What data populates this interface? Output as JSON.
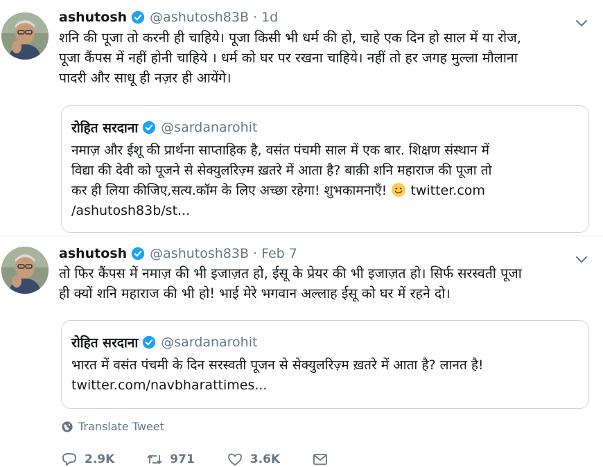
{
  "tweets": [
    {
      "name": "ashutosh",
      "handle": "@ashutosh83B",
      "separator": "·",
      "time": "1d",
      "text": "शनि की पूजा तो करनी ही चाहिये। पूजा किसी भी धर्म की हो, चाहे एक दिन हो साल में या रोज,\nपूजा कैंपस में नहीं होनी चाहिये । धर्म को घर पर रखना चाहिये। नहीं तो हर जगह मुल्ला मौलाना\nपादरी और साधू ही नज़र ही आयेंगे।",
      "quote": {
        "name": "रोहित सरदाना",
        "handle": "@sardanarohit",
        "text_main": "नमाज़ और ईशू की प्रार्थना साप्ताहिक है, वसंत पंचमी साल में एक बार. शिक्षण संस्थान में\nविद्या की देवी को पूजने से सेक्युलरिज़्म ख़तरे में आता है? बाक़ी शनि महाराज की पूजा तो\nकर ही लिया कीजिए,सत्य.कॉम के लिए अच्छा रहेगा! शुभकामनाएँ! ",
        "emoji_name": "smiling-face-emoji",
        "text_link": " twitter.com\n/ashutosh83b/st..."
      }
    },
    {
      "name": "ashutosh",
      "handle": "@ashutosh83B",
      "separator": "·",
      "time": "Feb 7",
      "text": "तो फिर कैंपस में नमाज़ की भी इजाज़त हो, ईसू के प्रेयर की भी इजाज़त हो। सिर्फ सरस्वती पूजा\nही क्यों शनि महाराज की भी हो! भाई मेरे भगवान अल्लाह ईसू को घर में रहने दो।",
      "quote": {
        "name": "रोहित सरदाना",
        "handle": "@sardanarohit",
        "text": "भारत में वसंत पंचमी के दिन सरस्वती पूजन से सेक्युलरिज़्म ख़तरे में आता है? लानत है!\ntwitter.com/navbharattimes..."
      },
      "translate_label": "Translate Tweet",
      "actions": {
        "reply_count": "2.9K",
        "retweet_count": "971",
        "like_count": "3.6K"
      }
    }
  ],
  "icons": {
    "verified": "verified-badge-icon",
    "caret": "chevron-down-icon",
    "globe": "globe-icon",
    "reply": "reply-icon",
    "retweet": "retweet-icon",
    "like": "heart-icon",
    "dm": "envelope-icon"
  },
  "colors": {
    "verified_blue": "#1da1f2",
    "muted_text": "#657786",
    "border": "#ccd6dd"
  }
}
